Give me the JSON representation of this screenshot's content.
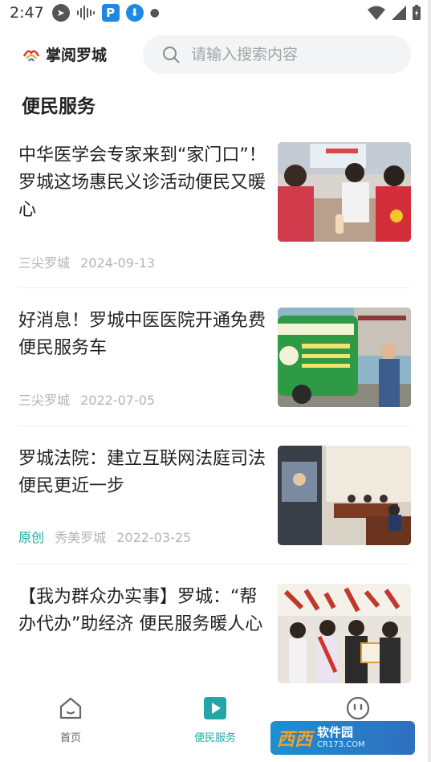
{
  "status_bar": {
    "time": "2:47",
    "icons": [
      "telegram-icon",
      "sound-wave-icon",
      "p-app-icon",
      "download-icon",
      "dot"
    ]
  },
  "header": {
    "app_title": "掌阅罗城",
    "search_placeholder": "请输入搜索内容"
  },
  "section_title": "便民服务",
  "articles": [
    {
      "title": "中华医学会专家来到“家门口”！罗城这场惠民义诊活动便民又暖心",
      "tag": "",
      "source": "三尖罗城",
      "date": "2024-09-13"
    },
    {
      "title": "好消息！罗城中医医院开通免费便民服务车",
      "tag": "",
      "source": "三尖罗城",
      "date": "2022-07-05"
    },
    {
      "title": "罗城法院：建立互联网法庭司法便民更近一步",
      "tag": "原创",
      "source": "秀美罗城",
      "date": "2022-03-25"
    },
    {
      "title": "【我为群众办实事】罗城：“帮办代办”助经济 便民服务暖人心",
      "tag": "",
      "source": "",
      "date": ""
    }
  ],
  "bottom_nav": {
    "items": [
      {
        "label": "首页",
        "icon": "home-icon",
        "active": false
      },
      {
        "label": "便民服务",
        "icon": "play-icon",
        "active": true
      },
      {
        "label": "",
        "icon": "smile-icon",
        "active": false
      }
    ]
  },
  "watermark": {
    "brand": "西西",
    "main": "软件园",
    "sub": "CR173.COM"
  },
  "colors": {
    "accent": "#20a7a8",
    "text": "#222222",
    "meta": "#b4b4b4",
    "search_bg": "#f3f4f6"
  }
}
